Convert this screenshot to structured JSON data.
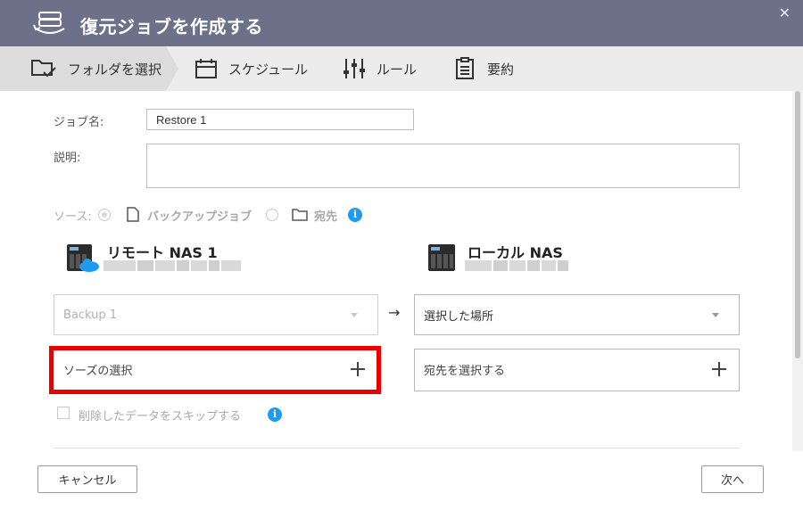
{
  "title": "復元ジョブを作成する",
  "close_label": "✕",
  "steps": [
    {
      "label": "フォルダを選択",
      "icon": "folder-check-icon",
      "active": true
    },
    {
      "label": "スケジュール",
      "icon": "calendar-icon",
      "active": false
    },
    {
      "label": "ルール",
      "icon": "sliders-icon",
      "active": false
    },
    {
      "label": "要約",
      "icon": "clipboard-list-icon",
      "active": false
    }
  ],
  "form": {
    "job_name_label": "ジョブ名:",
    "job_name_value": "Restore 1",
    "description_label": "説明:",
    "description_value": "",
    "source_label": "ソース:",
    "source_options": [
      {
        "label": "バックアップジョブ",
        "icon": "file-icon",
        "selected": true
      },
      {
        "label": "宛先",
        "icon": "folder-icon",
        "selected": false
      }
    ],
    "info_glyph": "i"
  },
  "remote": {
    "name": "リモート NAS 1",
    "icon": "nas-cloud-icon"
  },
  "local": {
    "name": "ローカル NAS",
    "icon": "nas-icon"
  },
  "arrow": "→",
  "source_select": {
    "value": "Backup 1",
    "disabled": true
  },
  "dest_select": {
    "value": "選択した場所"
  },
  "source_picker": {
    "label": "ソーズの選択"
  },
  "dest_picker": {
    "label": "宛先を選択する"
  },
  "skip_deleted": {
    "label": "削除したデータをスキップする",
    "checked": false
  },
  "buttons": {
    "cancel": "キャンセル",
    "next": "次へ"
  },
  "colors": {
    "titlebar": "#6c7089",
    "highlight": "#ea0000",
    "info": "#1e9bf0",
    "step_active": "#ffffff"
  }
}
